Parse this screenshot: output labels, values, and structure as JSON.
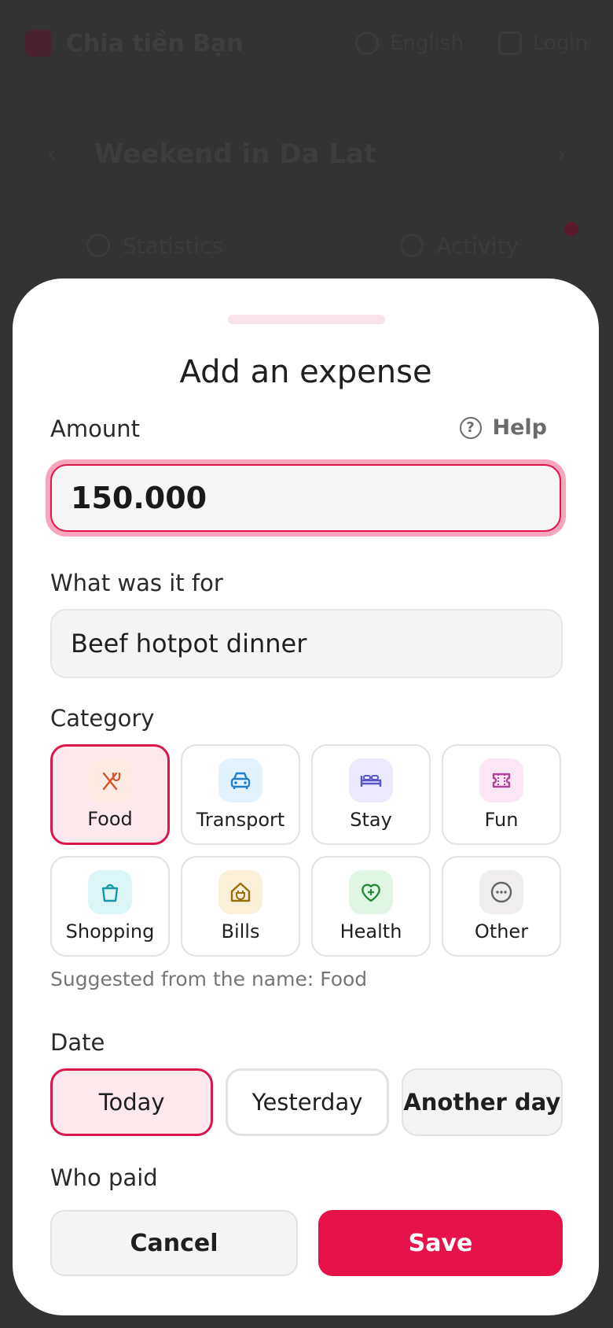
{
  "background": {
    "app_name": "Chia tiền Bạn",
    "language": "English",
    "login": "Login",
    "trip_title": "Weekend in Da Lat",
    "tab_statistics": "Statistics",
    "tab_activity": "Activity"
  },
  "sheet": {
    "title": "Add an expense",
    "amount_label": "Amount",
    "help_label": "Help",
    "amount_value": "150.000",
    "description_label": "What was it for",
    "description_value": "Beef hotpot dinner",
    "category_label": "Category",
    "categories": [
      {
        "label": "Food",
        "icon": "utensils-icon",
        "selected": true,
        "tint": "#fdebe3",
        "color": "#d2552a"
      },
      {
        "label": "Transport",
        "icon": "car-icon",
        "selected": false,
        "tint": "#e3f2fd",
        "color": "#1f7fd1"
      },
      {
        "label": "Stay",
        "icon": "bed-icon",
        "selected": false,
        "tint": "#ebe9fb",
        "color": "#5a55c6"
      },
      {
        "label": "Fun",
        "icon": "ticket-icon",
        "selected": false,
        "tint": "#fbe6f5",
        "color": "#b0429a"
      },
      {
        "label": "Shopping",
        "icon": "shopping-bag-icon",
        "selected": false,
        "tint": "#dcf5f7",
        "color": "#1798a6"
      },
      {
        "label": "Bills",
        "icon": "plug-house-icon",
        "selected": false,
        "tint": "#faf0d9",
        "color": "#9a6e0c"
      },
      {
        "label": "Health",
        "icon": "heart-plus-icon",
        "selected": false,
        "tint": "#e1f5e5",
        "color": "#258a3d"
      },
      {
        "label": "Other",
        "icon": "more-dots-icon",
        "selected": false,
        "tint": "#efeded",
        "color": "#666666"
      }
    ],
    "suggestion": "Suggested from the name: Food",
    "date_label": "Date",
    "date_options": [
      {
        "label": "Today",
        "selected": true
      },
      {
        "label": "Yesterday",
        "selected": false
      },
      {
        "label": "Another day",
        "selected": false
      }
    ],
    "payer_label": "Who paid",
    "cancel_label": "Cancel",
    "save_label": "Save"
  },
  "colors": {
    "accent": "#e8124a",
    "selected_fill": "#fde8ed",
    "overlay": "#333333"
  }
}
